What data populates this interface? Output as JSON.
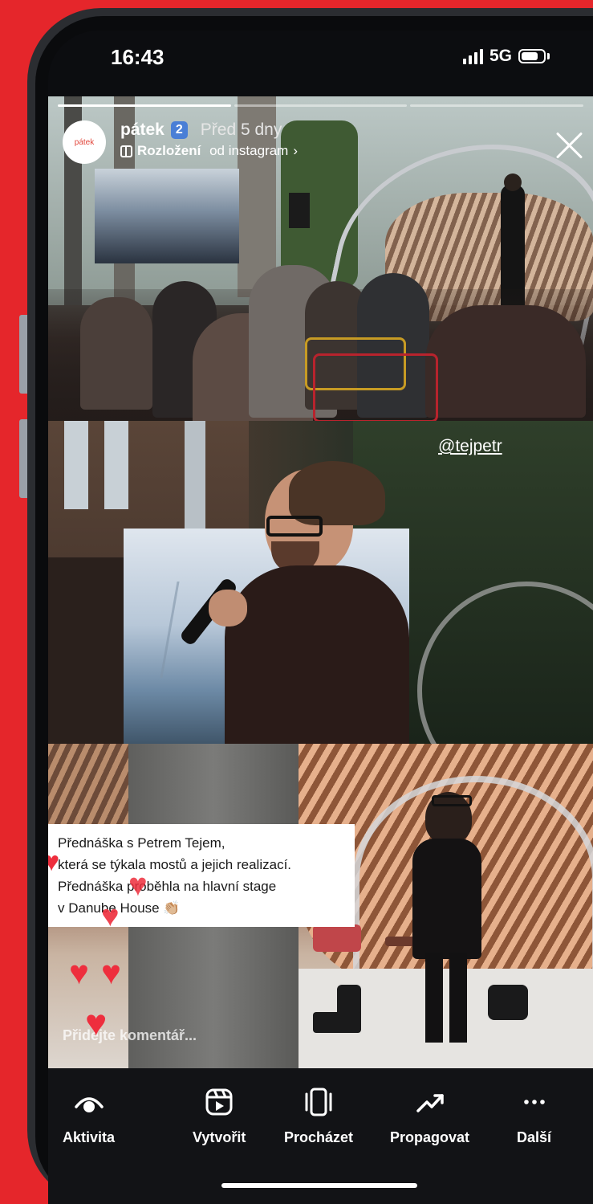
{
  "status_bar": {
    "time": "16:43",
    "network": "5G"
  },
  "story": {
    "progress": {
      "total": 3,
      "active": 1
    },
    "account": {
      "avatar_text": "pátek",
      "name": "pátek",
      "badge": "2",
      "time_ago": "Před 5 dny"
    },
    "layout_attribution": {
      "label_bold": "Rozložení",
      "label_rest": " od instagram",
      "chevron": "›"
    },
    "mention": "@tejpetr",
    "caption_lines": [
      "Přednáška s Petrem Tejem,",
      "která se týkala mostů a jejich realizací.",
      "Přednáška proběhla na hlavní stage",
      "v Danube House 👏🏼"
    ],
    "comment_placeholder": "Přidejte komentář..."
  },
  "bottom_nav": [
    {
      "label": "Aktivita",
      "icon": "eye-icon"
    },
    {
      "label": "Vytvořit",
      "icon": "reel-create-icon"
    },
    {
      "label": "Procházet",
      "icon": "carousel-icon"
    },
    {
      "label": "Propagovat",
      "icon": "trend-up-icon"
    },
    {
      "label": "Další",
      "icon": "more-dots-icon"
    }
  ],
  "colors": {
    "background": "#e5262b",
    "heart": "#ee2e3d",
    "badge": "#4a7fd6"
  }
}
